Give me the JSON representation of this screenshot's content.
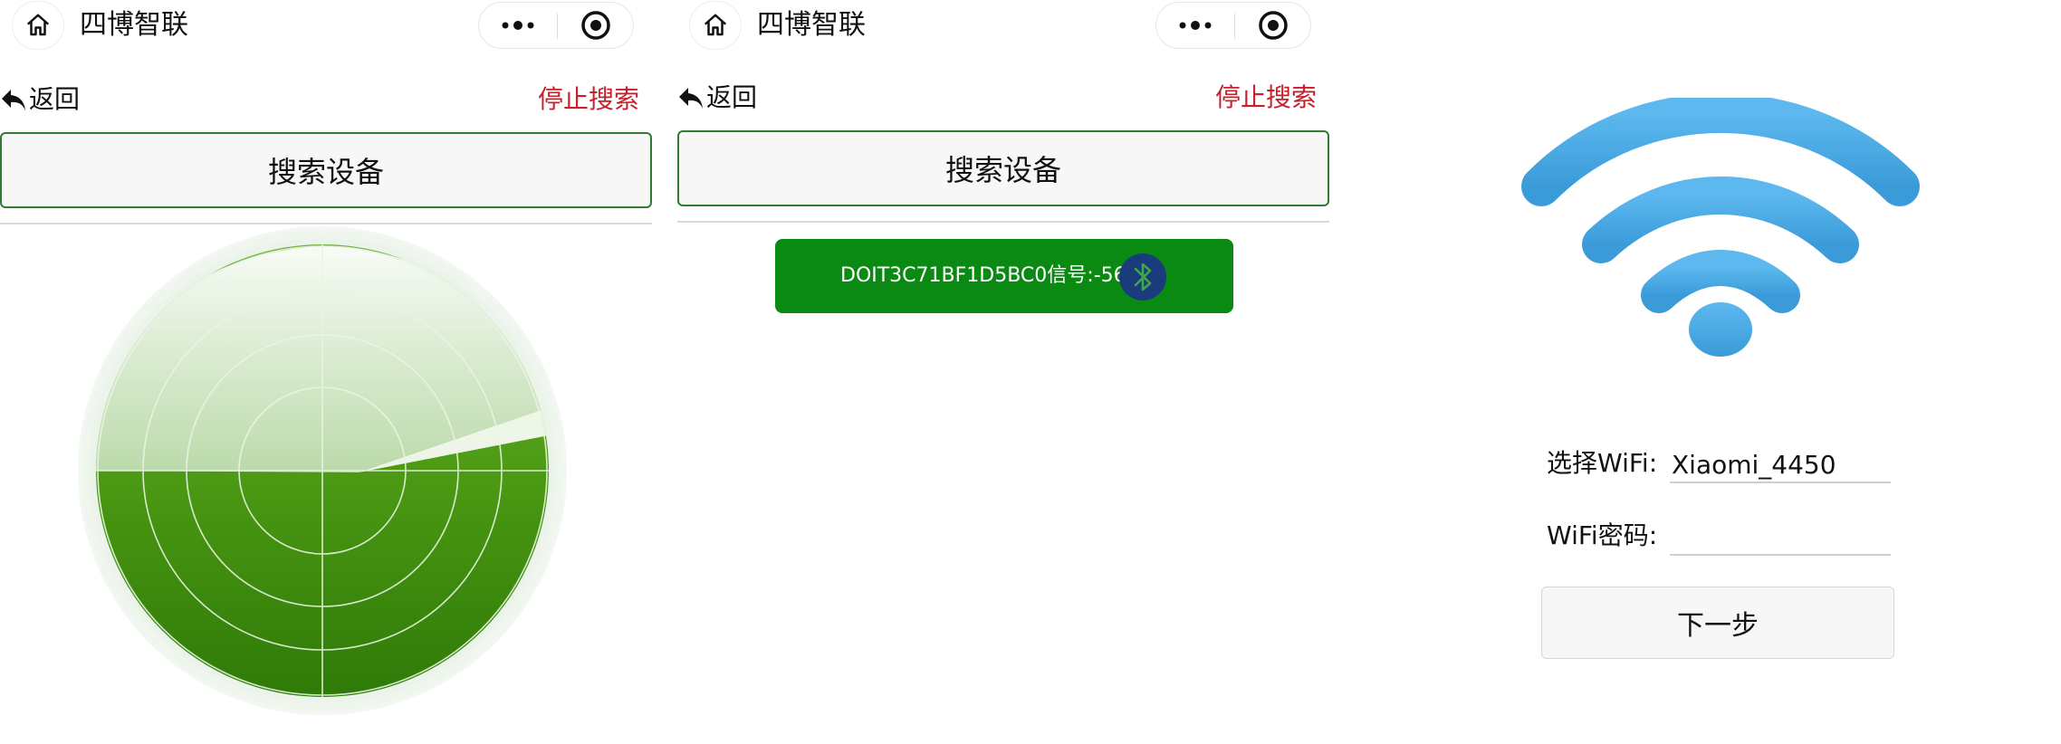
{
  "navbar": {
    "title": "四博智联",
    "home_icon": "home-icon",
    "more_icon": "more-dots-icon",
    "close_icon": "target-circle-icon"
  },
  "search_page": {
    "back_label": "返回",
    "stop_label": "停止搜索",
    "search_button": "搜索设备",
    "radar_icon": "radar-scan-icon"
  },
  "results_page": {
    "back_label": "返回",
    "stop_label": "停止搜索",
    "search_button": "搜索设备",
    "devices": [
      {
        "name": "DOIT3C71BF1D5BC0",
        "signal_label": "信号:",
        "signal": "-56",
        "icon": "bluetooth-icon"
      }
    ]
  },
  "wifi_page": {
    "wifi_icon": "wifi-icon",
    "ssid_label": "选择WiFi:",
    "ssid_value": "Xiaomi_4450",
    "password_label": "WiFi密码:",
    "password_value": "",
    "next_button": "下一步"
  },
  "colors": {
    "accent_green": "#2f7d32",
    "device_green": "#0a8a12",
    "stop_red": "#c8202a",
    "wifi_blue": "#4aa8e4",
    "bluetooth_bg": "#1a3b7c"
  }
}
